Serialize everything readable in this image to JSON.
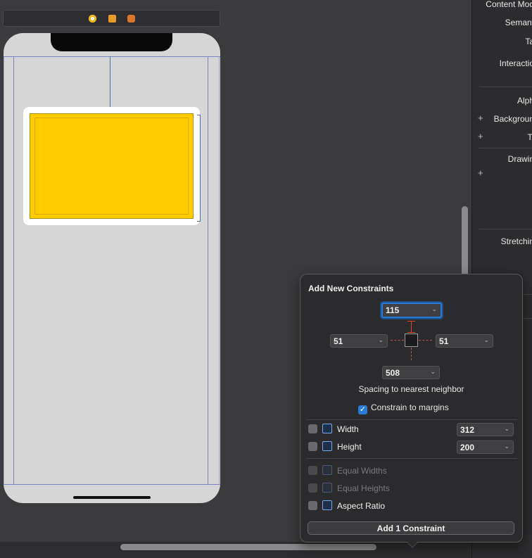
{
  "inspector": {
    "content_mode": "Content Mod",
    "semantic": "Semant",
    "tag": "Ta",
    "interaction": "Interactio",
    "alpha": "Alph",
    "background": "Backgroun",
    "tint": "Ti",
    "drawing": "Drawin",
    "stretching": "Stretchin"
  },
  "popover": {
    "title": "Add New Constraints",
    "top_value": "115",
    "left_value": "51",
    "right_value": "51",
    "bottom_value": "508",
    "spacing_label": "Spacing to nearest neighbor",
    "constrain_to_margins": "Constrain to margins",
    "constrain_to_margins_checked": true,
    "width": {
      "label": "Width",
      "value": "312",
      "checked": false
    },
    "height": {
      "label": "Height",
      "value": "200",
      "checked": false
    },
    "equal_widths": {
      "label": "Equal Widths",
      "enabled": false
    },
    "equal_heights": {
      "label": "Equal Heights",
      "enabled": false
    },
    "aspect_ratio": {
      "label": "Aspect Ratio",
      "checked": false
    },
    "add_button": "Add 1 Constraint",
    "chevron": "⌄"
  },
  "colors": {
    "yellow_view": "#ffcc00",
    "accent": "#2a7bd6",
    "strut": "#e0442b"
  },
  "icons": {
    "scene_bar": [
      "view-controller-icon",
      "first-responder-icon",
      "exit-icon"
    ],
    "options": [
      "width-icon",
      "height-icon",
      "equal-widths-icon",
      "equal-heights-icon",
      "aspect-ratio-icon"
    ]
  }
}
